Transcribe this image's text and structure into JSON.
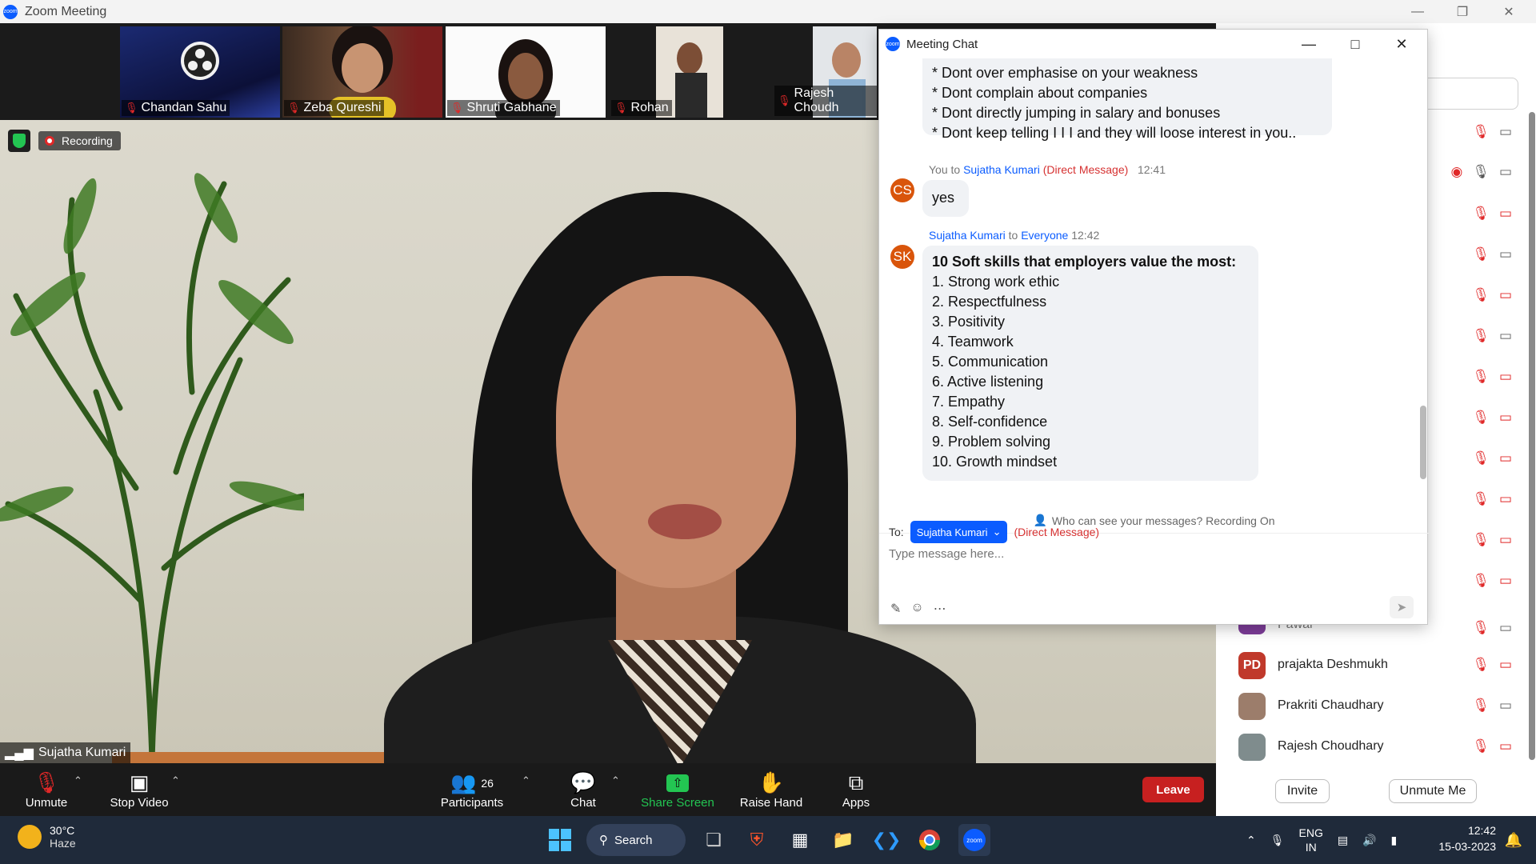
{
  "window": {
    "title": "Zoom Meeting",
    "logo_text": "zoom"
  },
  "thumbnails": [
    {
      "name": "Chandan Sahu"
    },
    {
      "name": "Zeba Qureshi"
    },
    {
      "name": "Shruti Gabhane"
    },
    {
      "name": "Rohan"
    },
    {
      "name": "Rajesh Choudh"
    }
  ],
  "main_video": {
    "status": "Recording",
    "speaker": "Sujatha Kumari"
  },
  "chat": {
    "title": "Meeting Chat",
    "prev_lines": [
      "* Dont over emphasise on your weakness",
      "* Dont complain about companies",
      "* Dont directly jumping in salary and bonuses",
      "* Dont keep telling I I I and they will loose interest in you.."
    ],
    "msg1": {
      "avatar": "CS",
      "you_to": "You to",
      "recipient": "Sujatha Kumari",
      "dm": "(Direct Message)",
      "time": "12:41",
      "text": "yes"
    },
    "msg2": {
      "avatar": "SK",
      "sender": "Sujatha Kumari",
      "to": "to",
      "audience": "Everyone",
      "time": "12:42",
      "heading": "10 Soft skills that employers value the most:",
      "items": [
        "1. Strong work ethic",
        "2. Respectfulness",
        "3. Positivity",
        "4. Teamwork",
        "5. Communication",
        "6. Active listening",
        "7. Empathy",
        "8. Self-confidence",
        "9. Problem solving",
        "10. Growth mindset"
      ]
    },
    "who_can_see": "Who can see your messages? Recording On",
    "to_label": "To:",
    "to_recipient": "Sujatha Kumari",
    "to_dm": "(Direct Message)",
    "input_placeholder": "Type message here..."
  },
  "participants": {
    "visible": [
      {
        "name": "prajakta Deshmukh",
        "initials": "PD",
        "color": "#c0392b"
      },
      {
        "name": "Prakriti Chaudhary",
        "initials": "",
        "color": "#9c7d6b"
      },
      {
        "name": "Rajesh Choudhary",
        "initials": "",
        "color": "#7f8c8d"
      }
    ],
    "partial_name": "Pawar",
    "invite_label": "Invite",
    "unmute_me_label": "Unmute Me"
  },
  "toolbar": {
    "unmute": "Unmute",
    "stop_video": "Stop Video",
    "participants": "Participants",
    "participants_count": "26",
    "chat": "Chat",
    "share_screen": "Share Screen",
    "raise_hand": "Raise Hand",
    "apps": "Apps",
    "leave": "Leave"
  },
  "taskbar": {
    "temp": "30°C",
    "weather": "Haze",
    "search": "Search",
    "lang1": "ENG",
    "lang2": "IN",
    "time": "12:42",
    "date": "15-03-2023"
  },
  "colors": {
    "zoom_blue": "#0b5cff",
    "leave_red": "#c72020",
    "share_green": "#23c552"
  }
}
